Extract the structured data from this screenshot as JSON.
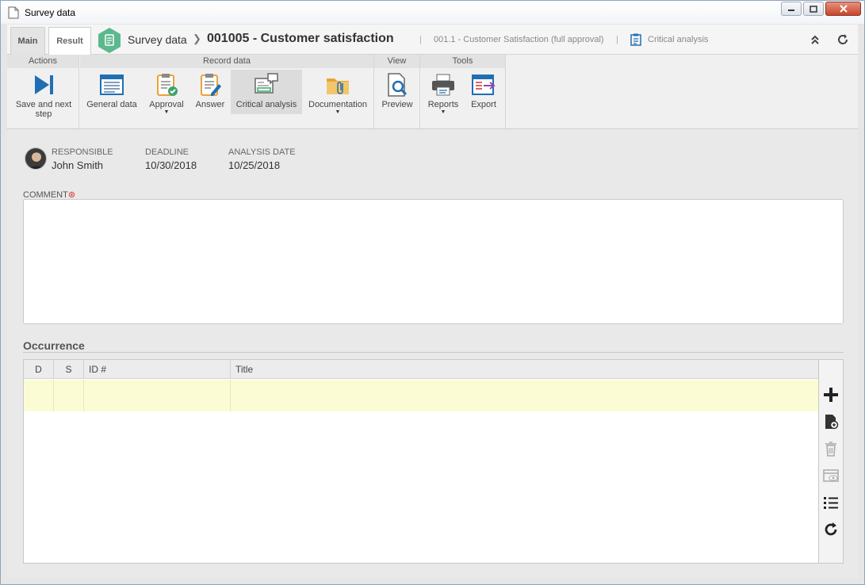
{
  "window": {
    "title": "Survey data"
  },
  "header": {
    "tabs": [
      {
        "label": "Main"
      },
      {
        "label": "Result"
      }
    ],
    "breadcrumb_module": "Survey data",
    "record_title": "001005 - Customer satisfaction",
    "sub_crumb_1": "001.1 - Customer Satisfaction (full approval)",
    "sub_crumb_2": "Critical analysis"
  },
  "ribbon": {
    "groups": {
      "actions": "Actions",
      "record_data": "Record data",
      "view": "View",
      "tools": "Tools"
    },
    "buttons": {
      "save_next_line1": "Save and next",
      "save_next_line2": "step",
      "general_data": "General data",
      "approval": "Approval",
      "answer": "Answer",
      "critical_analysis": "Critical analysis",
      "documentation": "Documentation",
      "preview": "Preview",
      "reports": "Reports",
      "export": "Export"
    }
  },
  "details": {
    "responsible_label": "RESPONSIBLE",
    "responsible_value": "John Smith",
    "deadline_label": "DEADLINE",
    "deadline_value": "10/30/2018",
    "analysis_date_label": "ANALYSIS DATE",
    "analysis_date_value": "10/25/2018",
    "comment_label": "COMMENT",
    "comment_value": ""
  },
  "occurrence": {
    "title": "Occurrence",
    "columns": [
      "D",
      "S",
      "ID #",
      "Title"
    ]
  },
  "colors": {
    "module_hex": "#5cb88e",
    "row_highlight": "#fcfcd4",
    "required": "#d9302c",
    "icon_blue": "#1f6fb2"
  },
  "icons": {
    "tools": [
      "add-icon",
      "new-record-icon",
      "delete-icon",
      "view-icon",
      "list-icon",
      "refresh-icon"
    ]
  }
}
